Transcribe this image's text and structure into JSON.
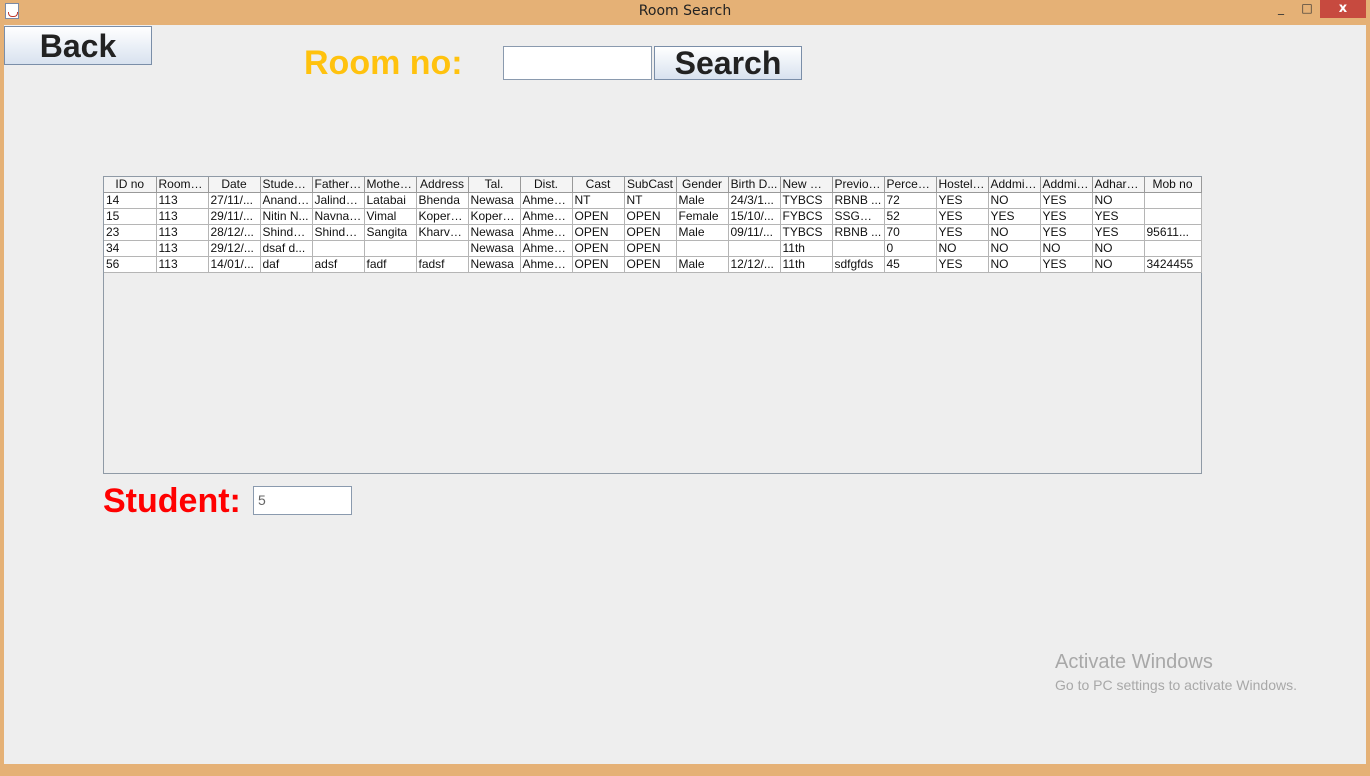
{
  "window": {
    "title": "Room Search",
    "minimize": "_",
    "maximize": "□",
    "close": "x"
  },
  "toolbar": {
    "back_label": "Back",
    "room_label": "Room no:",
    "room_value": "",
    "search_label": "Search"
  },
  "table": {
    "columns": [
      "ID no",
      "Room no",
      "Date",
      "Student...",
      "Father ...",
      "Mother ...",
      "Address",
      "Tal.",
      "Dist.",
      "Cast",
      "SubCast",
      "Gender",
      "Birth D...",
      "New Cl...",
      "Previou...",
      "Percent...",
      "Hostel ...",
      "Addmis...",
      "Addmis...",
      "Adhar C...",
      "Mob no"
    ],
    "rows": [
      [
        "14",
        "113",
        "27/11/...",
        "Anand ...",
        "Jalinda...",
        "Latabai",
        "Bhenda",
        "Newasa",
        "Ahmed...",
        "NT",
        "NT",
        "Male",
        "24/3/1...",
        "TYBCS",
        "RBNB ...",
        "72",
        "YES",
        "NO",
        "YES",
        "NO",
        ""
      ],
      [
        "15",
        "113",
        "29/11/...",
        "Nitin N...",
        "Navnat...",
        "Vimal",
        "Koperg...",
        "Koperg...",
        "Ahmed...",
        "OPEN",
        "OPEN",
        "Female",
        "15/10/...",
        "FYBCS",
        "SSGM ...",
        "52",
        "YES",
        "YES",
        "YES",
        "YES",
        ""
      ],
      [
        "23",
        "113",
        "28/12/...",
        "Shinde...",
        "Shinde...",
        "Sangita",
        "Kharva...",
        "Newasa",
        "Ahmed...",
        "OPEN",
        "OPEN",
        "Male",
        "09/11/...",
        "TYBCS",
        "RBNB ...",
        "70",
        "YES",
        "NO",
        "YES",
        "YES",
        "95611..."
      ],
      [
        "34",
        "113",
        "29/12/...",
        "dsaf d...",
        "",
        "",
        "",
        "Newasa",
        "Ahmed...",
        "OPEN",
        "OPEN",
        "",
        "",
        "11th",
        "",
        "0",
        "NO",
        "NO",
        "NO",
        "NO",
        ""
      ],
      [
        "56",
        "113",
        "14/01/...",
        "daf",
        "adsf",
        "fadf",
        "fadsf",
        "Newasa",
        "Ahmed...",
        "OPEN",
        "OPEN",
        "Male",
        "12/12/...",
        "11th",
        "sdfgfds",
        "45",
        "YES",
        "NO",
        "YES",
        "NO",
        "3424455"
      ]
    ]
  },
  "student": {
    "label": "Student:",
    "count": "5"
  },
  "watermark": {
    "title": "Activate Windows",
    "subtitle": "Go to PC settings to activate Windows."
  }
}
